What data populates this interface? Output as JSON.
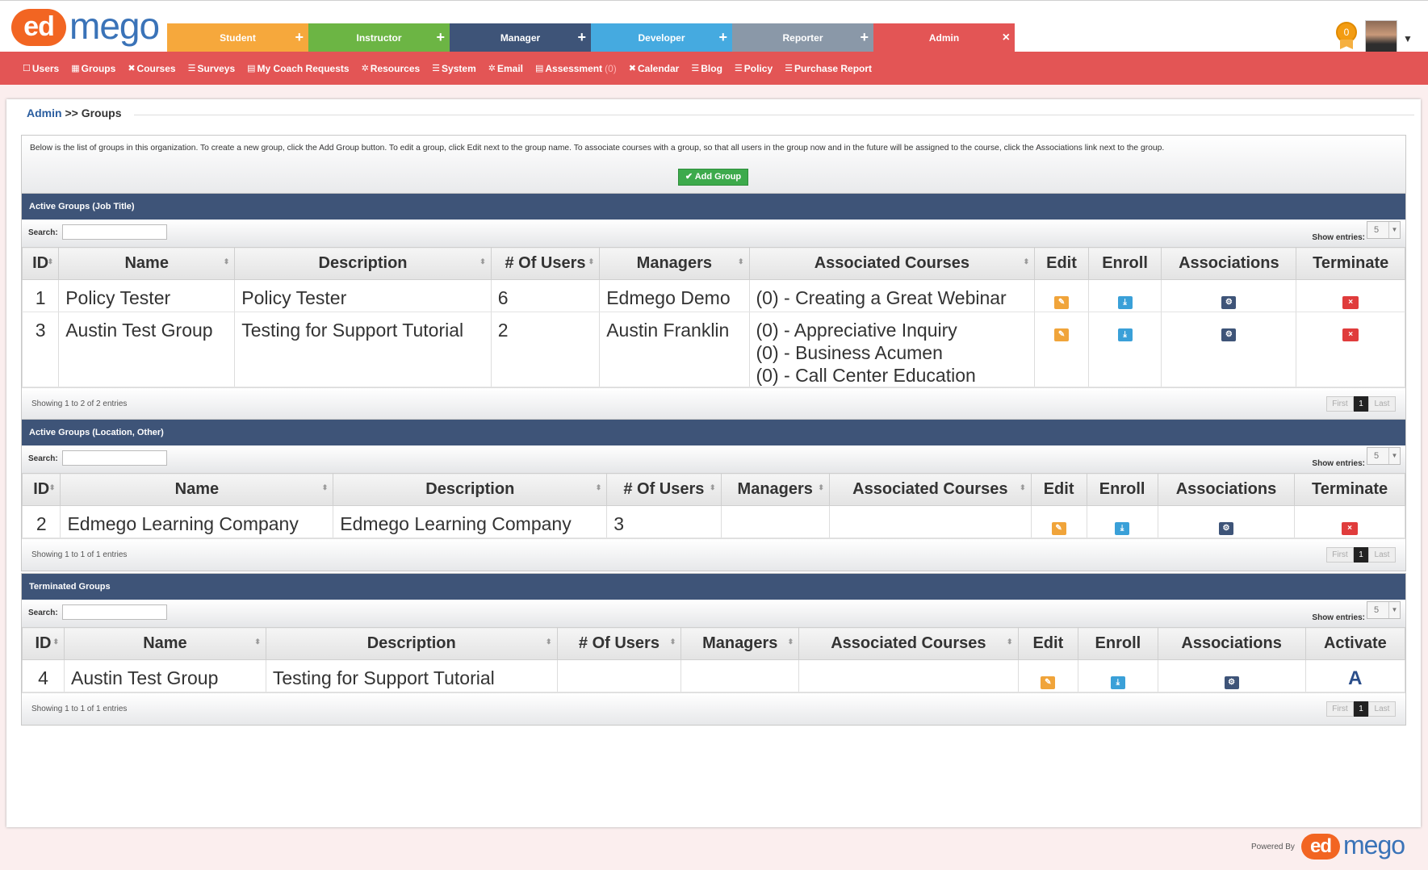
{
  "brand": {
    "logo_mark": "ed",
    "logo_word": "mego"
  },
  "colors": {
    "student": "#f6a83c",
    "instructor": "#6cb544",
    "manager": "#3e5478",
    "developer": "#45aae0",
    "reporter": "#8a98a8",
    "admin": "#e35555"
  },
  "role_tabs": [
    {
      "label": "Student",
      "symbol": "+"
    },
    {
      "label": "Instructor",
      "symbol": "+"
    },
    {
      "label": "Manager",
      "symbol": "+"
    },
    {
      "label": "Developer",
      "symbol": "+"
    },
    {
      "label": "Reporter",
      "symbol": "+"
    },
    {
      "label": "Admin",
      "symbol": "×"
    }
  ],
  "user": {
    "badge_count": "0",
    "menu_caret": "▼"
  },
  "admin_nav": [
    {
      "icon": "square-icon",
      "glyph": "☐",
      "label": "Users"
    },
    {
      "icon": "grid-icon",
      "glyph": "▦",
      "label": "Groups"
    },
    {
      "icon": "courses-icon",
      "glyph": "✖",
      "label": "Courses"
    },
    {
      "icon": "list-icon",
      "glyph": "☰",
      "label": "Surveys"
    },
    {
      "icon": "inbox-icon",
      "glyph": "▤",
      "label": "My Coach Requests"
    },
    {
      "icon": "gear-icon",
      "glyph": "✲",
      "label": "Resources"
    },
    {
      "icon": "list-icon",
      "glyph": "☰",
      "label": "System"
    },
    {
      "icon": "gear-icon",
      "glyph": "✲",
      "label": "Email"
    },
    {
      "icon": "chart-icon",
      "glyph": "▤",
      "label": "Assessment",
      "count": "(0)"
    },
    {
      "icon": "calendar-icon",
      "glyph": "✖",
      "label": "Calendar"
    },
    {
      "icon": "list-icon",
      "glyph": "☰",
      "label": "Blog"
    },
    {
      "icon": "list-icon",
      "glyph": "☰",
      "label": "Policy"
    },
    {
      "icon": "list-icon",
      "glyph": "☰",
      "label": "Purchase Report"
    }
  ],
  "breadcrumb": {
    "root": "Admin",
    "separator": ">>",
    "current": "Groups"
  },
  "info": {
    "text": "Below is the list of groups in this organization. To create a new group, click the Add Group button. To edit a group, click Edit next to the group name. To associate courses with a group, so that all users in the group now and in the future will be assigned to the course, click the Associations link next to the group.",
    "add_button": "✔ Add Group"
  },
  "panels": [
    {
      "title": "Active Groups (Job Title)",
      "search_label": "Search:",
      "entries_label": "Show entries:",
      "entries_value": "5",
      "headers": [
        "ID",
        "Name",
        "Description",
        "# Of Users",
        "Managers",
        "Associated Courses",
        "Edit",
        "Enroll",
        "Associations",
        "Terminate"
      ],
      "rows": [
        {
          "id": "1",
          "name": "Policy Tester",
          "description": "Policy Tester",
          "users": "6",
          "managers": "Edmego Demo",
          "courses": [
            "(0) - Creating a Great Webinar"
          ]
        },
        {
          "id": "3",
          "name": "Austin Test Group",
          "description": "Testing for Support Tutorial",
          "users": "2",
          "managers": "Austin Franklin",
          "courses": [
            "(0) - Appreciative Inquiry",
            "(0) - Business Acumen",
            "(0) - Call Center Education"
          ]
        }
      ],
      "footer": "Showing 1 to 2 of 2 entries",
      "pager": {
        "first": "First",
        "page": "1",
        "last": "Last"
      }
    },
    {
      "title": "Active Groups (Location, Other)",
      "search_label": "Search:",
      "entries_label": "Show entries:",
      "entries_value": "5",
      "headers": [
        "ID",
        "Name",
        "Description",
        "# Of Users",
        "Managers",
        "Associated Courses",
        "Edit",
        "Enroll",
        "Associations",
        "Terminate"
      ],
      "rows": [
        {
          "id": "2",
          "name": "Edmego Learning Company",
          "description": "Edmego Learning Company",
          "users": "3",
          "managers": "",
          "courses": []
        }
      ],
      "footer": "Showing 1 to 1 of 1 entries",
      "pager": {
        "first": "First",
        "page": "1",
        "last": "Last"
      }
    },
    {
      "title": "Terminated Groups",
      "search_label": "Search:",
      "entries_label": "Show entries:",
      "entries_value": "5",
      "headers": [
        "ID",
        "Name",
        "Description",
        "# Of Users",
        "Managers",
        "Associated Courses",
        "Edit",
        "Enroll",
        "Associations",
        "Activate"
      ],
      "rows": [
        {
          "id": "4",
          "name": "Austin Test Group",
          "description": "Testing for Support Tutorial",
          "users": "",
          "managers": "",
          "courses": [],
          "activate": "A"
        }
      ],
      "footer": "Showing 1 to 1 of 1 entries",
      "pager": {
        "first": "First",
        "page": "1",
        "last": "Last"
      }
    }
  ],
  "footer": {
    "powered_by": "Powered By"
  }
}
